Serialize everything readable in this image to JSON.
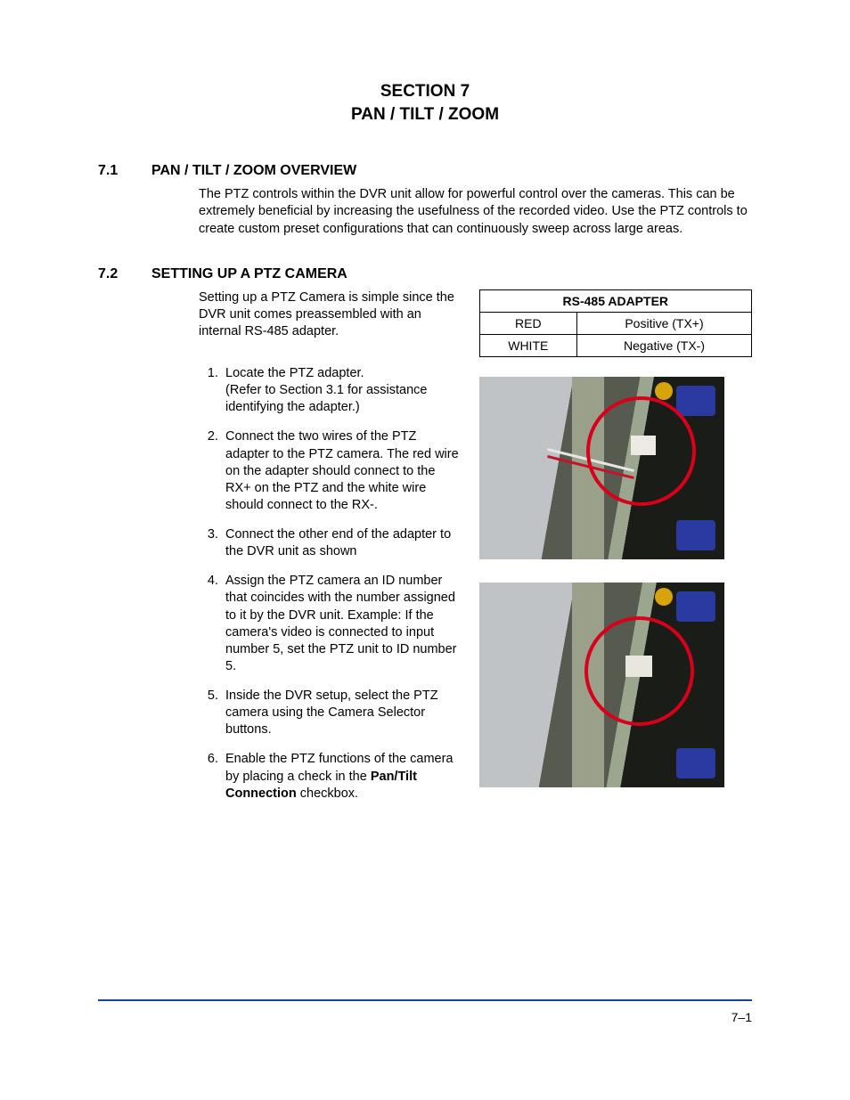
{
  "title": {
    "l1": "SECTION 7",
    "l2": "PAN / TILT / ZOOM"
  },
  "s71": {
    "num": "7.1",
    "title": "PAN / TILT / ZOOM OVERVIEW",
    "body": "The PTZ controls within the DVR unit allow for powerful control over the cameras. This can be extremely beneficial by increasing the usefulness of the recorded video. Use the PTZ controls to create custom preset configurations that can continuously sweep across large areas."
  },
  "s72": {
    "num": "7.2",
    "title": "SETTING UP A PTZ CAMERA",
    "intro": "Setting up a PTZ Camera is simple since the DVR unit comes preassembled with an internal RS-485 adapter.",
    "steps": [
      "Locate the PTZ adapter.\n(Refer to Section 3.1 for assistance identifying the adapter.)",
      "Connect the two wires of the PTZ adapter to the PTZ camera. The red wire on the adapter should connect to the RX+ on the PTZ and the white wire should connect to the RX-.",
      "Connect the other end of the adapter to the DVR unit as shown",
      "Assign the PTZ camera an ID number that coincides with the number assigned to it by the DVR unit.  Example:  If the camera's video is connected to input number 5, set the PTZ unit to ID number 5.",
      "Inside the DVR setup, select the PTZ camera using the Camera Selector buttons."
    ],
    "step6_a": "Enable the PTZ functions of the camera by placing a check in the ",
    "step6_b": "Pan/Tilt Connection",
    "step6_c": " checkbox."
  },
  "table": {
    "header": "RS-485 ADAPTER",
    "rows": [
      {
        "a": "RED",
        "b": "Positive (TX+)"
      },
      {
        "a": "WHITE",
        "b": "Negative (TX-)"
      }
    ]
  },
  "pagenum": "7–1"
}
